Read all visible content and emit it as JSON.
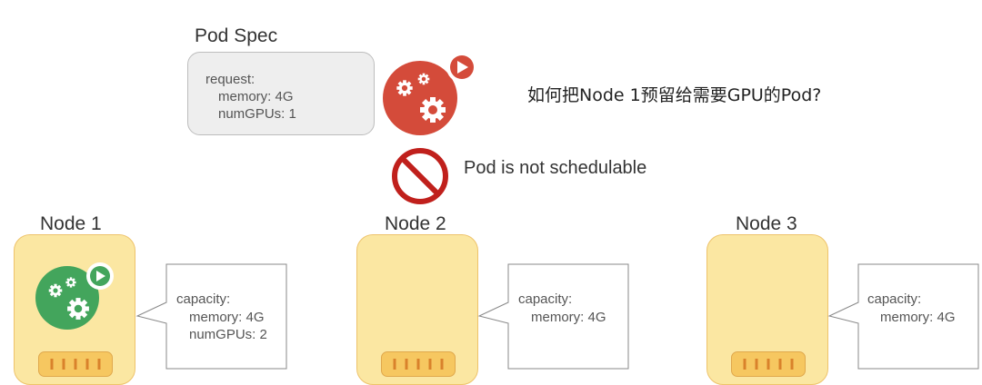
{
  "pod_spec": {
    "title": "Pod Spec",
    "request_label": "request:",
    "memory": "memory: 4G",
    "gpus": "numGPUs: 1"
  },
  "question": "如何把Node 1预留给需要GPU的Pod?",
  "status": "Pod is not schedulable",
  "nodes": [
    {
      "name": "Node 1",
      "capacity_label": "capacity:",
      "memory": "memory: 4G",
      "gpus": "numGPUs: 2"
    },
    {
      "name": "Node 2",
      "capacity_label": "capacity:",
      "memory": "memory: 4G"
    },
    {
      "name": "Node 3",
      "capacity_label": "capacity:",
      "memory": "memory: 4G"
    }
  ],
  "colors": {
    "pending_pod": "#d44b3a",
    "running_pod": "#43a55c",
    "node_fill": "#fbe7a2",
    "node_border": "#eec36b",
    "port_fill": "#f6c760",
    "no_sign": "#c0201c"
  },
  "icons": {
    "pending_pod": "gears-play-icon",
    "running_pod": "gears-play-icon",
    "status": "prohibited-icon"
  }
}
